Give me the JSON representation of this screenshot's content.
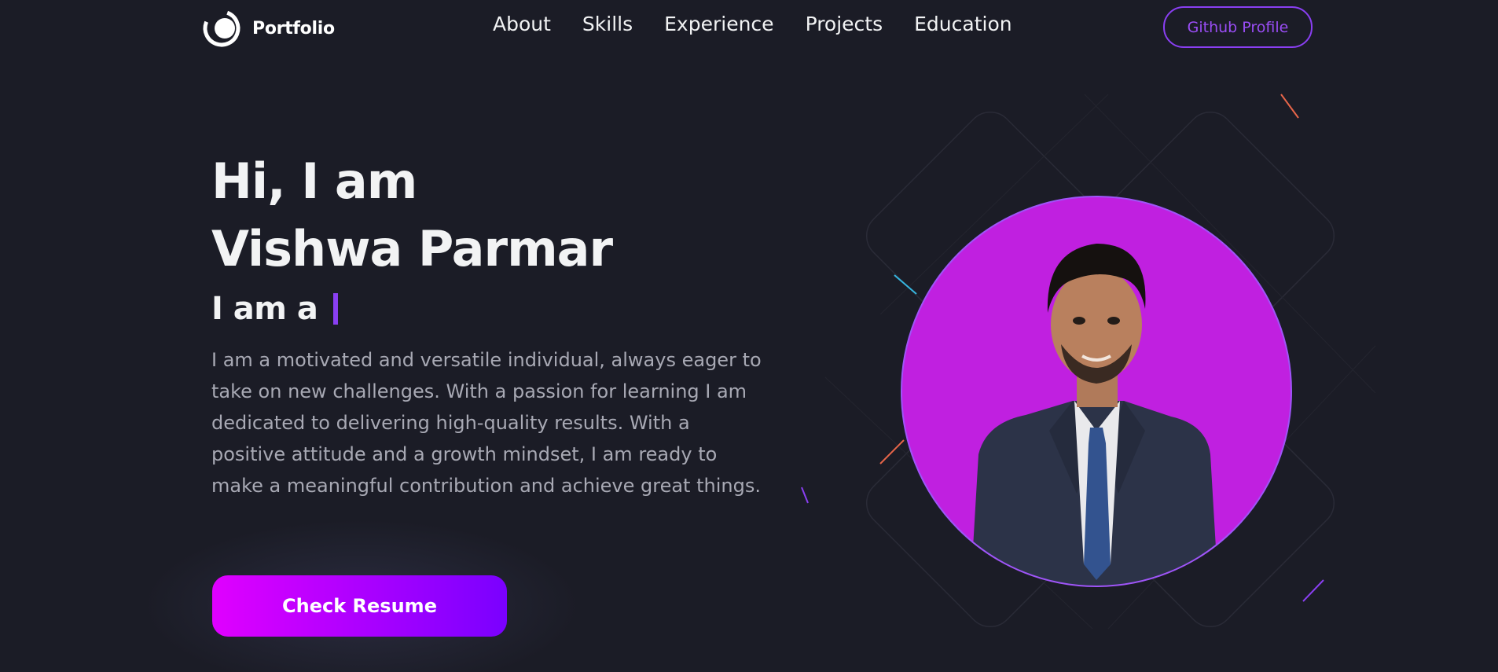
{
  "nav": {
    "brand": "Portfolio",
    "links": [
      "About",
      "Skills",
      "Experience",
      "Projects",
      "Education"
    ],
    "github_label": "Github Profile"
  },
  "hero": {
    "greeting": "Hi, I am",
    "name": "Vishwa Parmar",
    "role_prefix": "I am a",
    "bio": "I am a motivated and versatile individual, always eager to take on new challenges. With a passion for learning I am dedicated to delivering high-quality results. With a positive attitude and a growth mindset, I am ready to make a meaningful contribution and achieve great things.",
    "resume_label": "Check Resume"
  },
  "colors": {
    "background": "#1b1c26",
    "accent": "#8a3ff2",
    "portrait_bg": "#c020e0",
    "button_gradient_start": "#e000ff",
    "button_gradient_end": "#7a00ff"
  },
  "icons": {
    "logo": "portfolio-ring-logo"
  }
}
